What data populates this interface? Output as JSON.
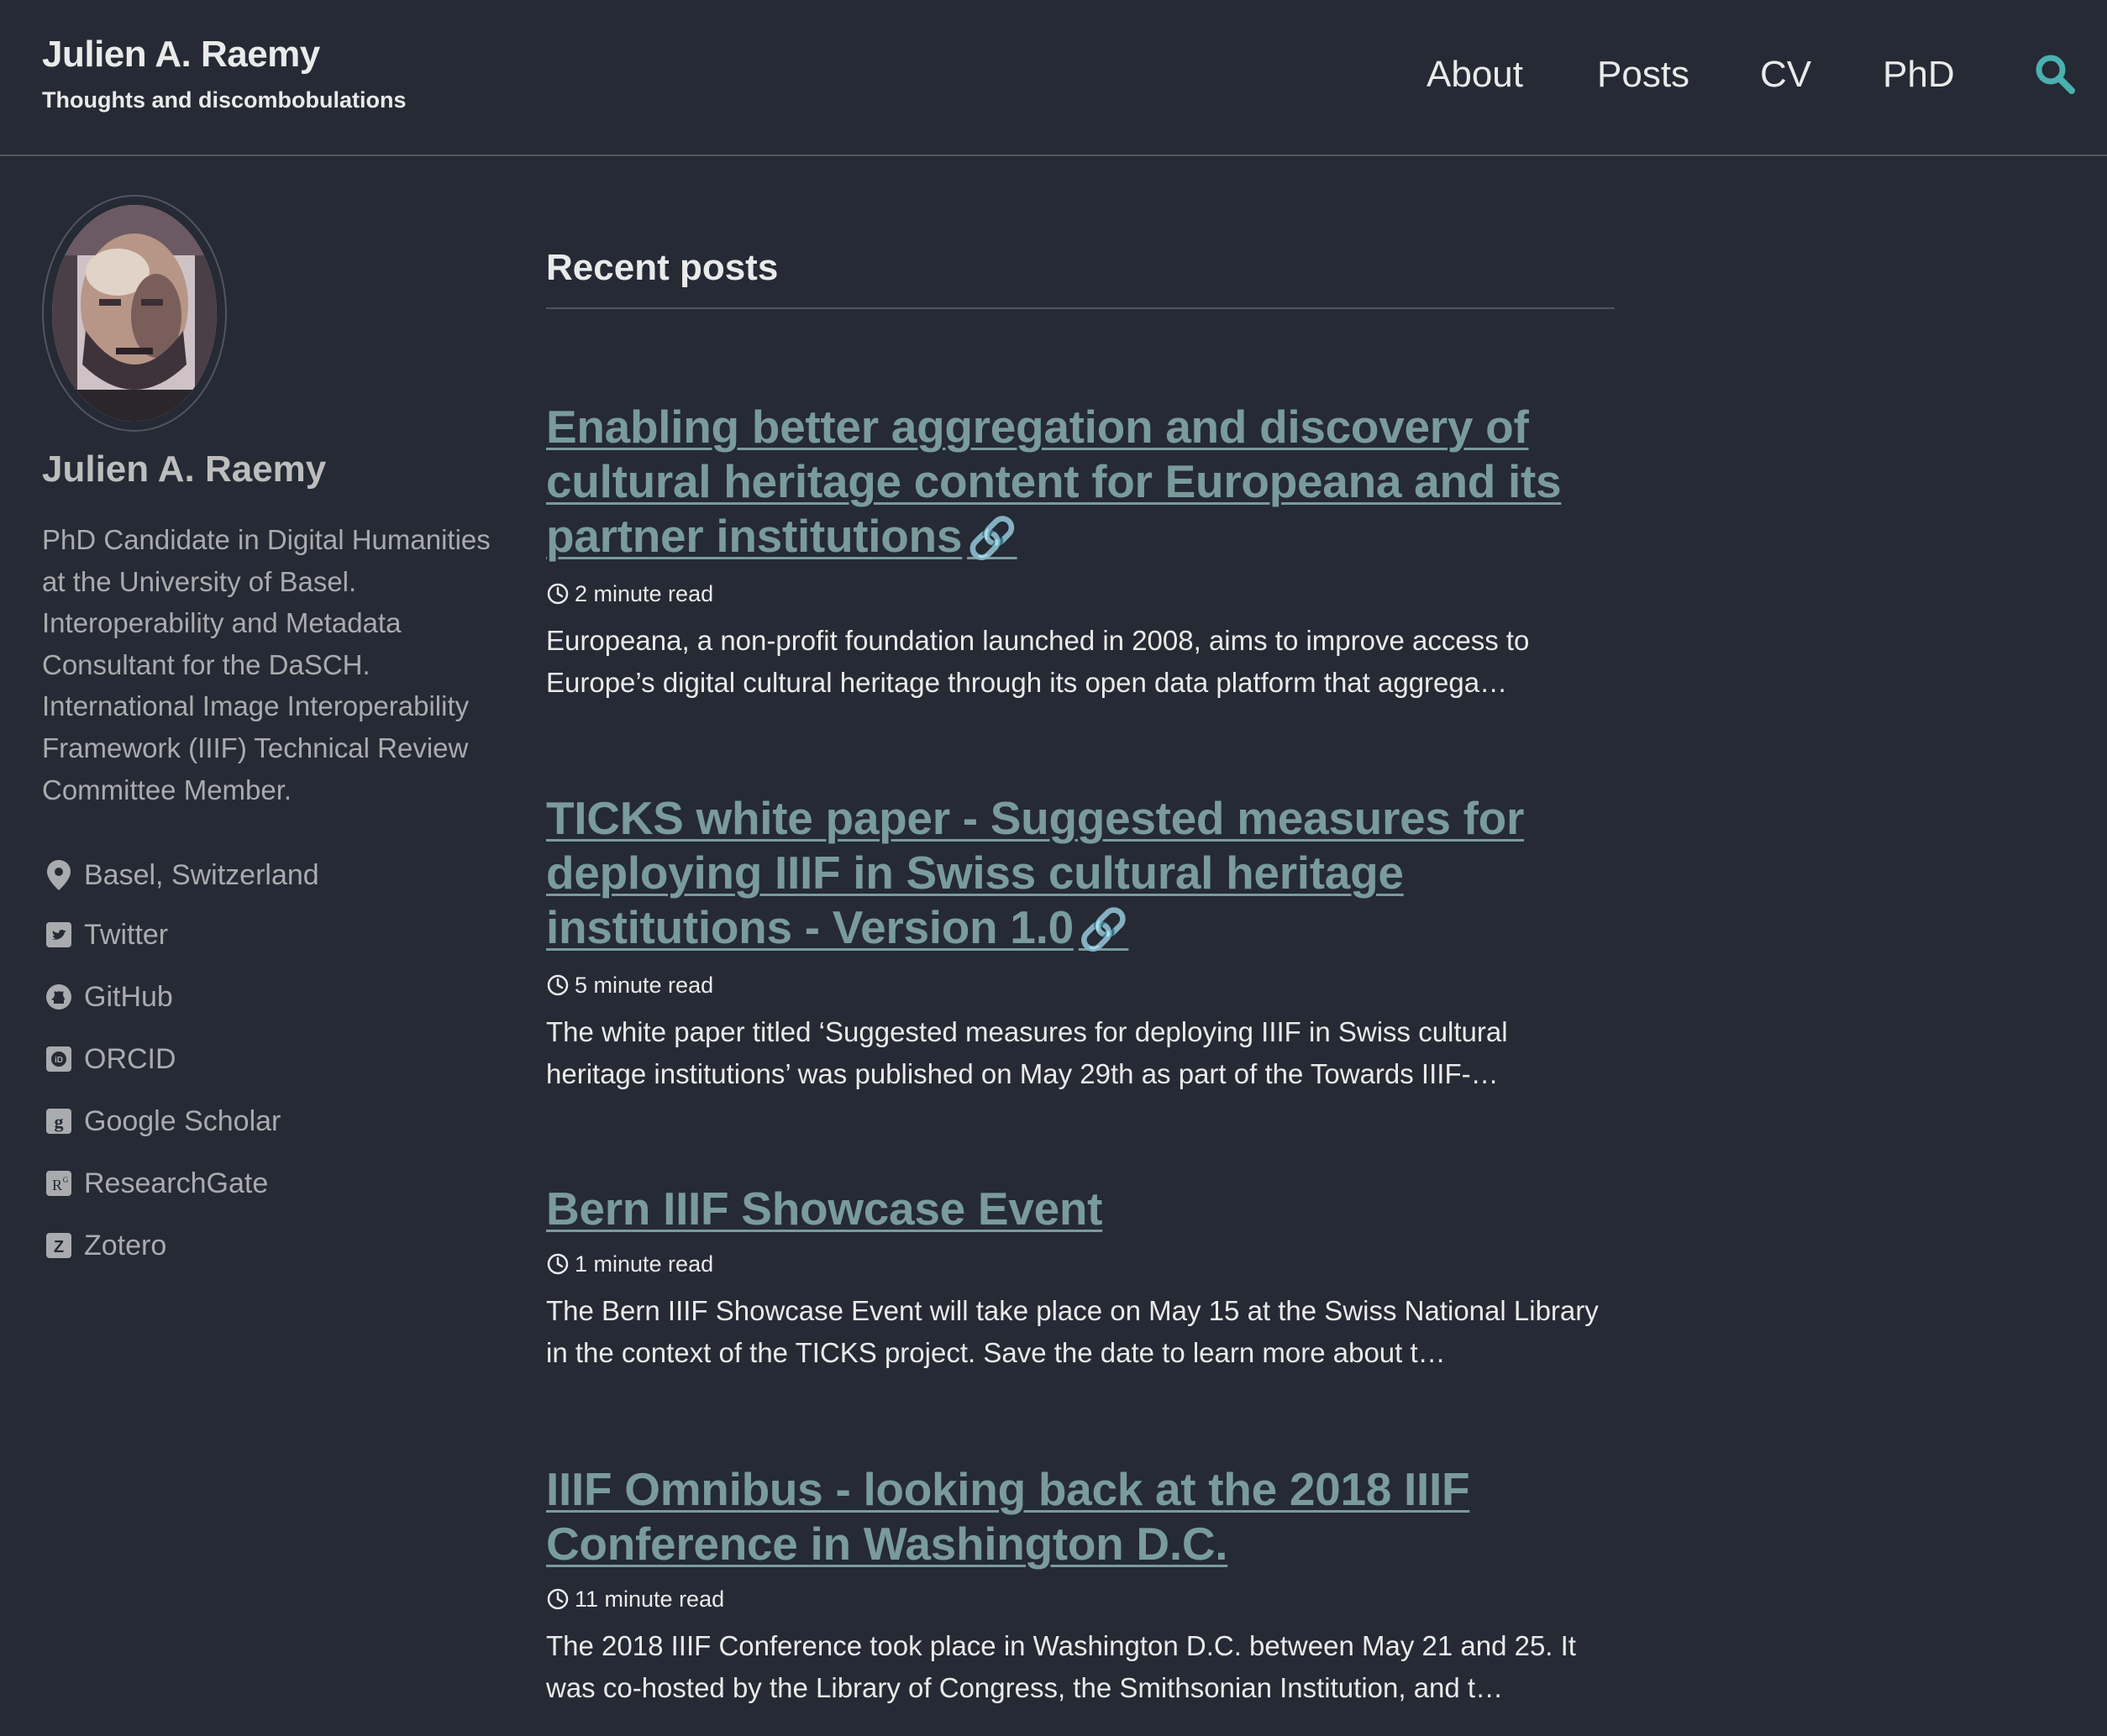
{
  "masthead": {
    "title": "Julien A. Raemy",
    "subtitle": "Thoughts and discombobulations",
    "nav": [
      "About",
      "Posts",
      "CV",
      "PhD"
    ],
    "search_icon": "search-icon",
    "accent_color": "#4ab0b0"
  },
  "sidebar": {
    "name": "Julien A. Raemy",
    "bio": "PhD Candidate in Digital Humanities at the University of Basel. Interoperability and Metadata Consultant for the DaSCH. International Image Interoperability Framework (IIIF) Technical Review Committee Member.",
    "location": "Basel, Switzerland",
    "links": [
      {
        "label": "Twitter",
        "icon": "twitter-icon"
      },
      {
        "label": "GitHub",
        "icon": "github-icon"
      },
      {
        "label": "ORCID",
        "icon": "orcid-icon"
      },
      {
        "label": "Google Scholar",
        "icon": "google-scholar-icon"
      },
      {
        "label": "ResearchGate",
        "icon": "researchgate-icon"
      },
      {
        "label": "Zotero",
        "icon": "zotero-icon"
      }
    ]
  },
  "main": {
    "section_title": "Recent posts",
    "link_color": "#7a9b9b",
    "posts": [
      {
        "title": "Enabling better aggregation and discovery of cultural heritage content for Europeana and its partner institutions",
        "read_time": "2 minute read",
        "excerpt": "Europeana, a non-profit foundation launched in 2008, aims to improve access to Europe’s digital cultural heritage through its open data platform that aggrega…"
      },
      {
        "title": "TICKS white paper - Suggested measures for deploying IIIF in Swiss cultural heritage institutions - Version 1.0",
        "read_time": "5 minute read",
        "excerpt": "The white paper titled ‘Suggested measures for deploying IIIF in Swiss cultural heritage institutions’ was published on May 29th as part of the Towards IIIF-…"
      },
      {
        "title": "Bern IIIF Showcase Event",
        "read_time": "1 minute read",
        "excerpt": "The Bern IIIF Showcase Event will take place on May 15 at the Swiss National Library in the context of the TICKS project. Save the date to learn more about t…"
      },
      {
        "title": "IIIF Omnibus - looking back at the 2018 IIIF Conference in Washington D.C.",
        "read_time": "11 minute read",
        "excerpt": "The 2018 IIIF Conference took place in Washington D.C. between May 21 and 25. It was co-hosted by the Library of Congress, the Smithsonian Institution, and t…"
      }
    ]
  }
}
